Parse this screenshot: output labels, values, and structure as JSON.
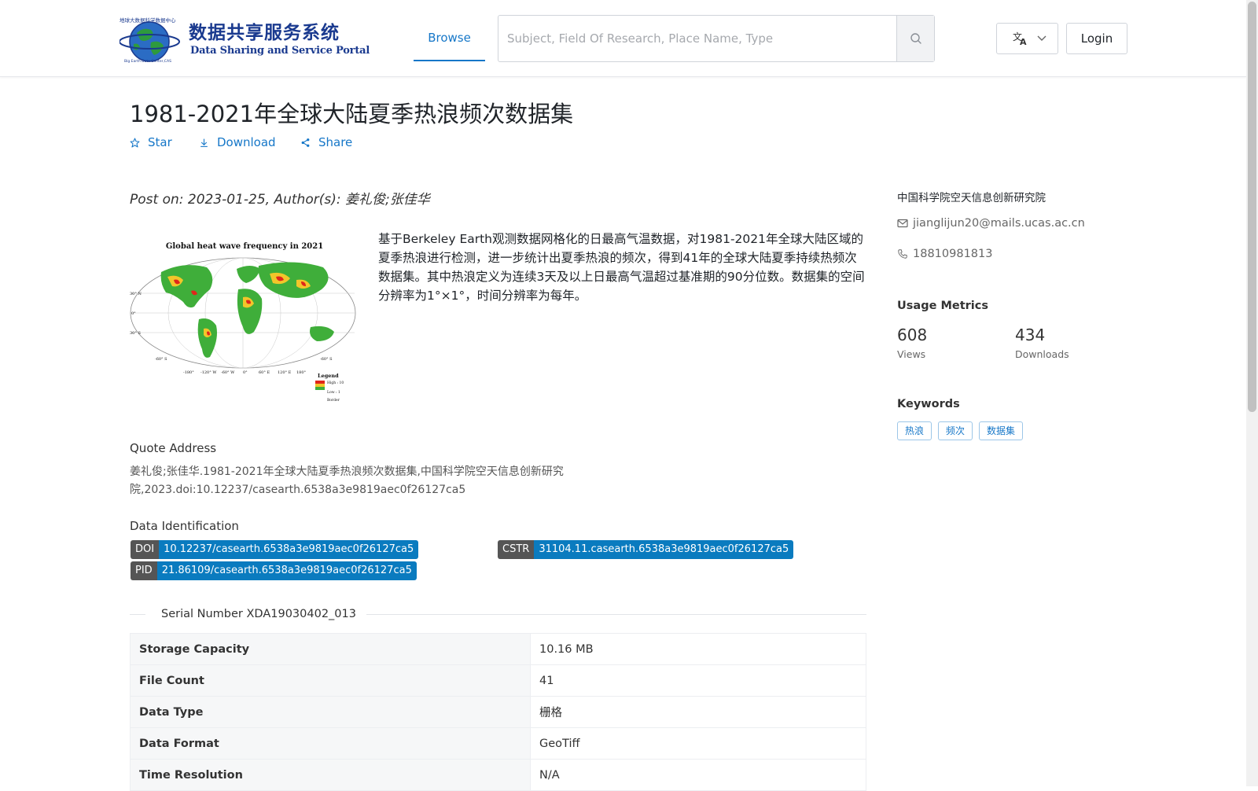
{
  "header": {
    "logo_zh": "数据共享服务系统",
    "logo_en": "Data Sharing and Service Portal",
    "nav_browse": "Browse",
    "search_placeholder": "Subject, Field Of Research, Place Name, Type",
    "search_icon": "search-icon",
    "language_icon": "translate-icon",
    "login_label": "Login"
  },
  "dataset": {
    "title": "1981-2021年全球大陆夏季热浪频次数据集",
    "actions": {
      "star": "Star",
      "download": "Download",
      "share": "Share"
    },
    "post_on": "Post on: 2023-01-25, Author(s): 姜礼俊;张佳华",
    "thumbnail": {
      "title": "Global heat wave frequency in 2021",
      "legend_title": "Legend",
      "legend_high": "High : 10",
      "legend_low": "Low : 1",
      "legend_border": "Border"
    },
    "abstract": "基于Berkeley Earth观测数据网格化的日最高气温数据，对1981-2021年全球大陆区域的夏季热浪进行检测，进一步统计出夏季热浪的频次，得到41年的全球大陆夏季持续热频次数据集。其中热浪定义为连续3天及以上日最高气温超过基准期的90分位数。数据集的空间分辨率为1°×1°，时间分辨率为每年。",
    "quote": {
      "label": "Quote Address",
      "text": "姜礼俊;张佳华.1981-2021年全球大陆夏季热浪频次数据集,中国科学院空天信息创新研究院,2023.doi:10.12237/casearth.6538a3e9819aec0f26127ca5"
    },
    "identification": {
      "label": "Data Identification",
      "doi_key": "DOI",
      "doi_value": "10.12237/casearth.6538a3e9819aec0f26127ca5",
      "cstr_key": "CSTR",
      "cstr_value": "31104.11.casearth.6538a3e9819aec0f26127ca5",
      "pid_key": "PID",
      "pid_value": "21.86109/casearth.6538a3e9819aec0f26127ca5"
    },
    "serial_number": "Serial Number XDA19030402_013",
    "specs": [
      {
        "key": "Storage Capacity",
        "value": "10.16 MB"
      },
      {
        "key": "File Count",
        "value": "41"
      },
      {
        "key": "Data Type",
        "value": "栅格"
      },
      {
        "key": "Data Format",
        "value": "GeoTiff"
      },
      {
        "key": "Time Resolution",
        "value": "N/A"
      }
    ]
  },
  "sidebar": {
    "organization": "中国科学院空天信息创新研究院",
    "email": "jianglijun20@mails.ucas.ac.cn",
    "email_icon": "mail-icon",
    "phone": "18810981813",
    "phone_icon": "phone-icon",
    "usage_heading": "Usage Metrics",
    "views_count": "608",
    "views_label": "Views",
    "downloads_count": "434",
    "downloads_label": "Downloads",
    "keywords_heading": "Keywords",
    "keywords": [
      "热浪",
      "频次",
      "数据集"
    ]
  },
  "colors": {
    "accent": "#1677c8",
    "badge_key": "#555555",
    "badge_value": "#0a7bbf",
    "logo_blue": "#1a3a8f"
  }
}
